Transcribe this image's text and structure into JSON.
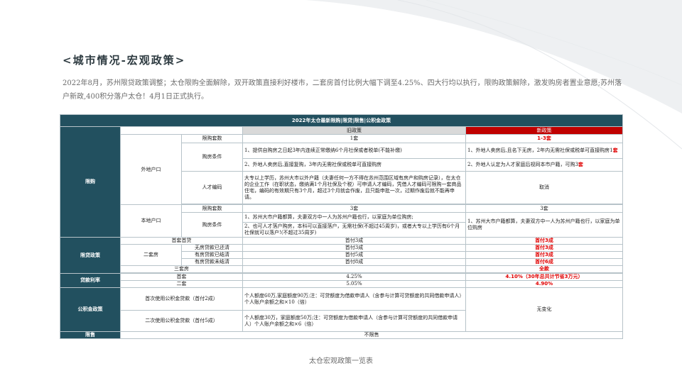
{
  "heading": "<城市情况-宏观政策>",
  "intro": "2022年8月，苏州限贷政策调整；太仓限购全面解除，双开政策直接利好楼市，二套房首付比例大幅下调至4.25%、四大行均以执行，限购政策解除，激发购房者置业意愿;苏州落户新政,400积分落户太仓！4月1日正式执行。",
  "table": {
    "title": "2022年太仓最新限购|限贷|限售|公积金政策",
    "old_header": "旧政策",
    "new_header": "新政策",
    "restrict": {
      "label": "限购",
      "nonlocal": {
        "label": "外地户口",
        "count_label": "限购套数",
        "count_old": "1套",
        "count_new": "1-3套",
        "cond_label": "购房条件",
        "cond_old_1": "1、提供自购房之日起3年内连续正常缴纳6个月社保或者税单(不能补缴)",
        "cond_old_2": "2、外地人卖房后,直接复购，3年内无需社保或税单可直接购房",
        "cond_new_1a": "1、外地人卖房后,且名下无房，2年内无需社保或税单可直接购房1",
        "cond_new_1b": "套",
        "cond_new_2a": "2、外地人认定为人才家庭后视同本市户籍，可购3",
        "cond_new_2b": "套",
        "talent_label": "人才编码",
        "talent_old": "大专以上学历，苏州大市以外户籍（夫妻任何一方不得在苏州范围区域有房产和购房记录），在太仓的企业工作（在职状态，缴纳满1个月社保及个税）可申请人才编码，凭借人才编码可限购一套商品住宅，编码的有效期只有3个月，超过3个月就会作废，且只能申批一次，过期作废后就不能再申请。",
        "talent_new": "取消"
      },
      "local": {
        "label": "本地户口",
        "count_label": "限购套数",
        "count_old": "3套",
        "count_new": "3套",
        "cond_label": "购房条件",
        "cond_old_1": "1、苏州大市户籍都算，夫妻双方中一人为苏州户籍也行，以家庭为单位购房;",
        "cond_old_2": "2、也可人才落户购房，本科可以直接落户，无需社保(不超过45周岁)，或者大专以上学历有6个月社保就可以落户!(不超过35周岁)",
        "cond_new": "1、苏州大市户籍都算，夫妻双方中一人为苏州户籍也行，以家庭为单位购房"
      }
    },
    "loan": {
      "label": "限贷政策",
      "first_label": "首套首贷",
      "first_old": "首付3成",
      "first_new": "首付3成",
      "second_label": "二套房",
      "rows": [
        {
          "label": "无房贷款已还清",
          "old": "首付3成",
          "new": "首付3成"
        },
        {
          "label": "有房贷款已结清",
          "old": "首付5成",
          "new": "首付3成"
        },
        {
          "label": "有房贷款未结清",
          "old": "首付8成",
          "new": "首付6成"
        }
      ],
      "third_label": "三套房",
      "third_old": "",
      "third_new": "全款"
    },
    "rate": {
      "label": "贷款利率",
      "first_label": "首套",
      "first_old": "4.25%",
      "first_new": "4.10%（30年总共计节省3万元）",
      "second_label": "二套",
      "second_old": "5.05%",
      "second_new": "4.90%"
    },
    "fund": {
      "label": "公积金政策",
      "first_label": "首次使用公积金贷款（首付2成）",
      "first_old": "个人额度60万,家庭额度90万;注：可贷额度为借款申请人（含参与计算可贷额度的共同借款申请人）个人账户余额之和×10（倍）",
      "second_label": "二次使用公积金贷款（首付5成）",
      "second_old": "个人额度30万，家庭额度50万;注：可贷额度为借款申请人（含参与计算可贷额度的共同借款申请人）个人账户余额之和×6（倍）",
      "new": "无变化"
    },
    "resale": {
      "label": "限售",
      "value": "不限售"
    }
  },
  "caption": "太仓宏观政策一览表"
}
